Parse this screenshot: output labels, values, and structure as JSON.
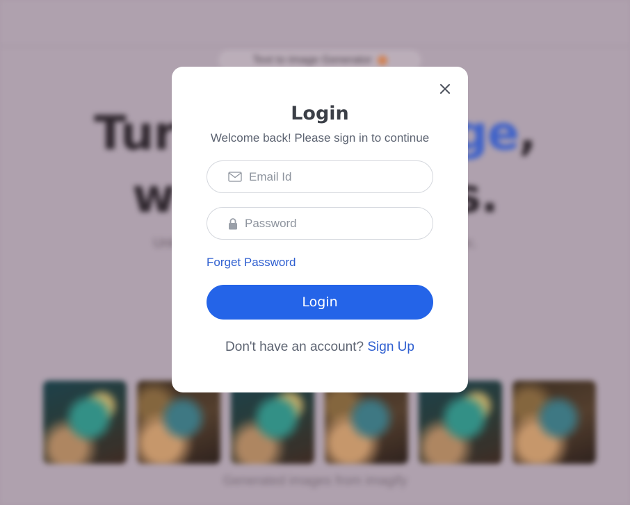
{
  "background": {
    "badge": {
      "label": "Text to image Generator",
      "icon": "star-icon"
    },
    "headline": {
      "line1_start": "Tur",
      "line1_accent": "ge",
      "line1_end": ",",
      "line2_start": "w",
      "line2_end": "s."
    },
    "subtitle": "Unleash yo                                                   antic magic.",
    "caption": "Generated images from imagify",
    "gallery_count": 6
  },
  "modal": {
    "title": "Login",
    "subtitle": "Welcome back! Please sign in to continue",
    "close_icon": "close-icon",
    "email": {
      "placeholder": "Email Id",
      "value": "",
      "icon": "mail-icon"
    },
    "password": {
      "placeholder": "Password",
      "value": "",
      "icon": "lock-icon"
    },
    "forgot_label": "Forget Password",
    "login_label": "Login",
    "signup_prompt": "Don't have an account?",
    "signup_link": "Sign Up"
  },
  "colors": {
    "accent": "#2464e8",
    "link": "#2f5fd0",
    "overlay": "#b5a8b3"
  }
}
